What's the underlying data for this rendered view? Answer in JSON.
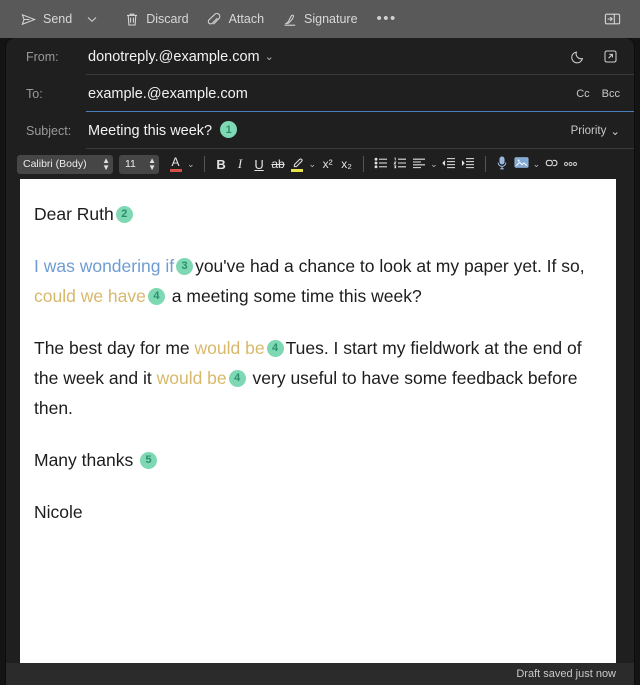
{
  "command_bar": {
    "send_label": "Send",
    "send_icon": "send-paper-plane-icon",
    "send_caret_icon": "chevron-down-icon",
    "discard_label": "Discard",
    "discard_icon": "trash-icon",
    "attach_label": "Attach",
    "attach_icon": "paperclip-icon",
    "signature_label": "Signature",
    "signature_icon": "signature-pen-icon",
    "more_label": "•••",
    "more_icon": "more-options-icon",
    "reading_pane_icon": "reading-pane-icon"
  },
  "headers": {
    "from": {
      "label": "From:",
      "value": "donotreply.@example.com",
      "caret": "⌄",
      "moon_icon": "moon-icon",
      "boxed_icon": "open-in-new-icon"
    },
    "to": {
      "label": "To:",
      "value": "example.@example.com",
      "placeholder": "",
      "cc_label": "Cc",
      "bcc_label": "Bcc"
    },
    "subject": {
      "label": "Subject:",
      "value": "Meeting this week?",
      "badge": "1",
      "priority_label": "Priority",
      "priority_caret": "⌄"
    }
  },
  "format_toolbar": {
    "font_family": "Calibri (Body)",
    "font_size": "11",
    "font_color_icon": "font-color-icon",
    "font_color_caret": "⌄",
    "bold": "B",
    "italic": "I",
    "underline": "U",
    "strikethrough": "ab",
    "highlight_icon": "highlight-marker-icon",
    "highlight_caret": "⌄",
    "superscript": "x²",
    "subscript": "x₂",
    "bullet_list_icon": "bulleted-list-icon",
    "numbered_list_icon": "numbered-list-icon",
    "align_icon": "align-left-icon",
    "align_caret": "⌄",
    "decrease_indent_icon": "decrease-indent-icon",
    "increase_indent_icon": "increase-indent-icon",
    "dictate_icon": "microphone-icon",
    "picture_icon": "insert-picture-icon",
    "picture_caret": "⌄",
    "link_icon": "insert-link-icon",
    "more_icon": "more-formatting-icon"
  },
  "body": {
    "greeting": {
      "text": "Dear Ruth",
      "badge": "2"
    },
    "paragraph1": {
      "blue_text": "I was wondering if",
      "badge_a": "3",
      "mid_text": "you've had a chance to look at my paper yet. If so,",
      "gold_text": "could we have",
      "badge_b": "4",
      "end_text": "a meeting some time this week?"
    },
    "paragraph2": {
      "start_text": "The best day for me",
      "gold_text_a": "would be",
      "badge_a": "4",
      "mid_text": "Tues. I start my fieldwork at the end of the week and it",
      "gold_text_b": "would be",
      "badge_b": "4",
      "end_text": "very useful to have some feedback before then."
    },
    "closing": {
      "text": "Many thanks",
      "badge": "5"
    },
    "signature": "Nicole"
  },
  "status_bar": {
    "text": "Draft saved just now"
  },
  "colors": {
    "badge_bg": "#7fd8b4",
    "badge_text": "#2a8f6d",
    "blue_text": "#6e9cd2",
    "gold_text": "#d8b96b",
    "focus_underline": "#4a7ebb",
    "command_bar_bg": "#595959",
    "window_bg": "#1f1f1f",
    "page_bg": "#141414"
  }
}
